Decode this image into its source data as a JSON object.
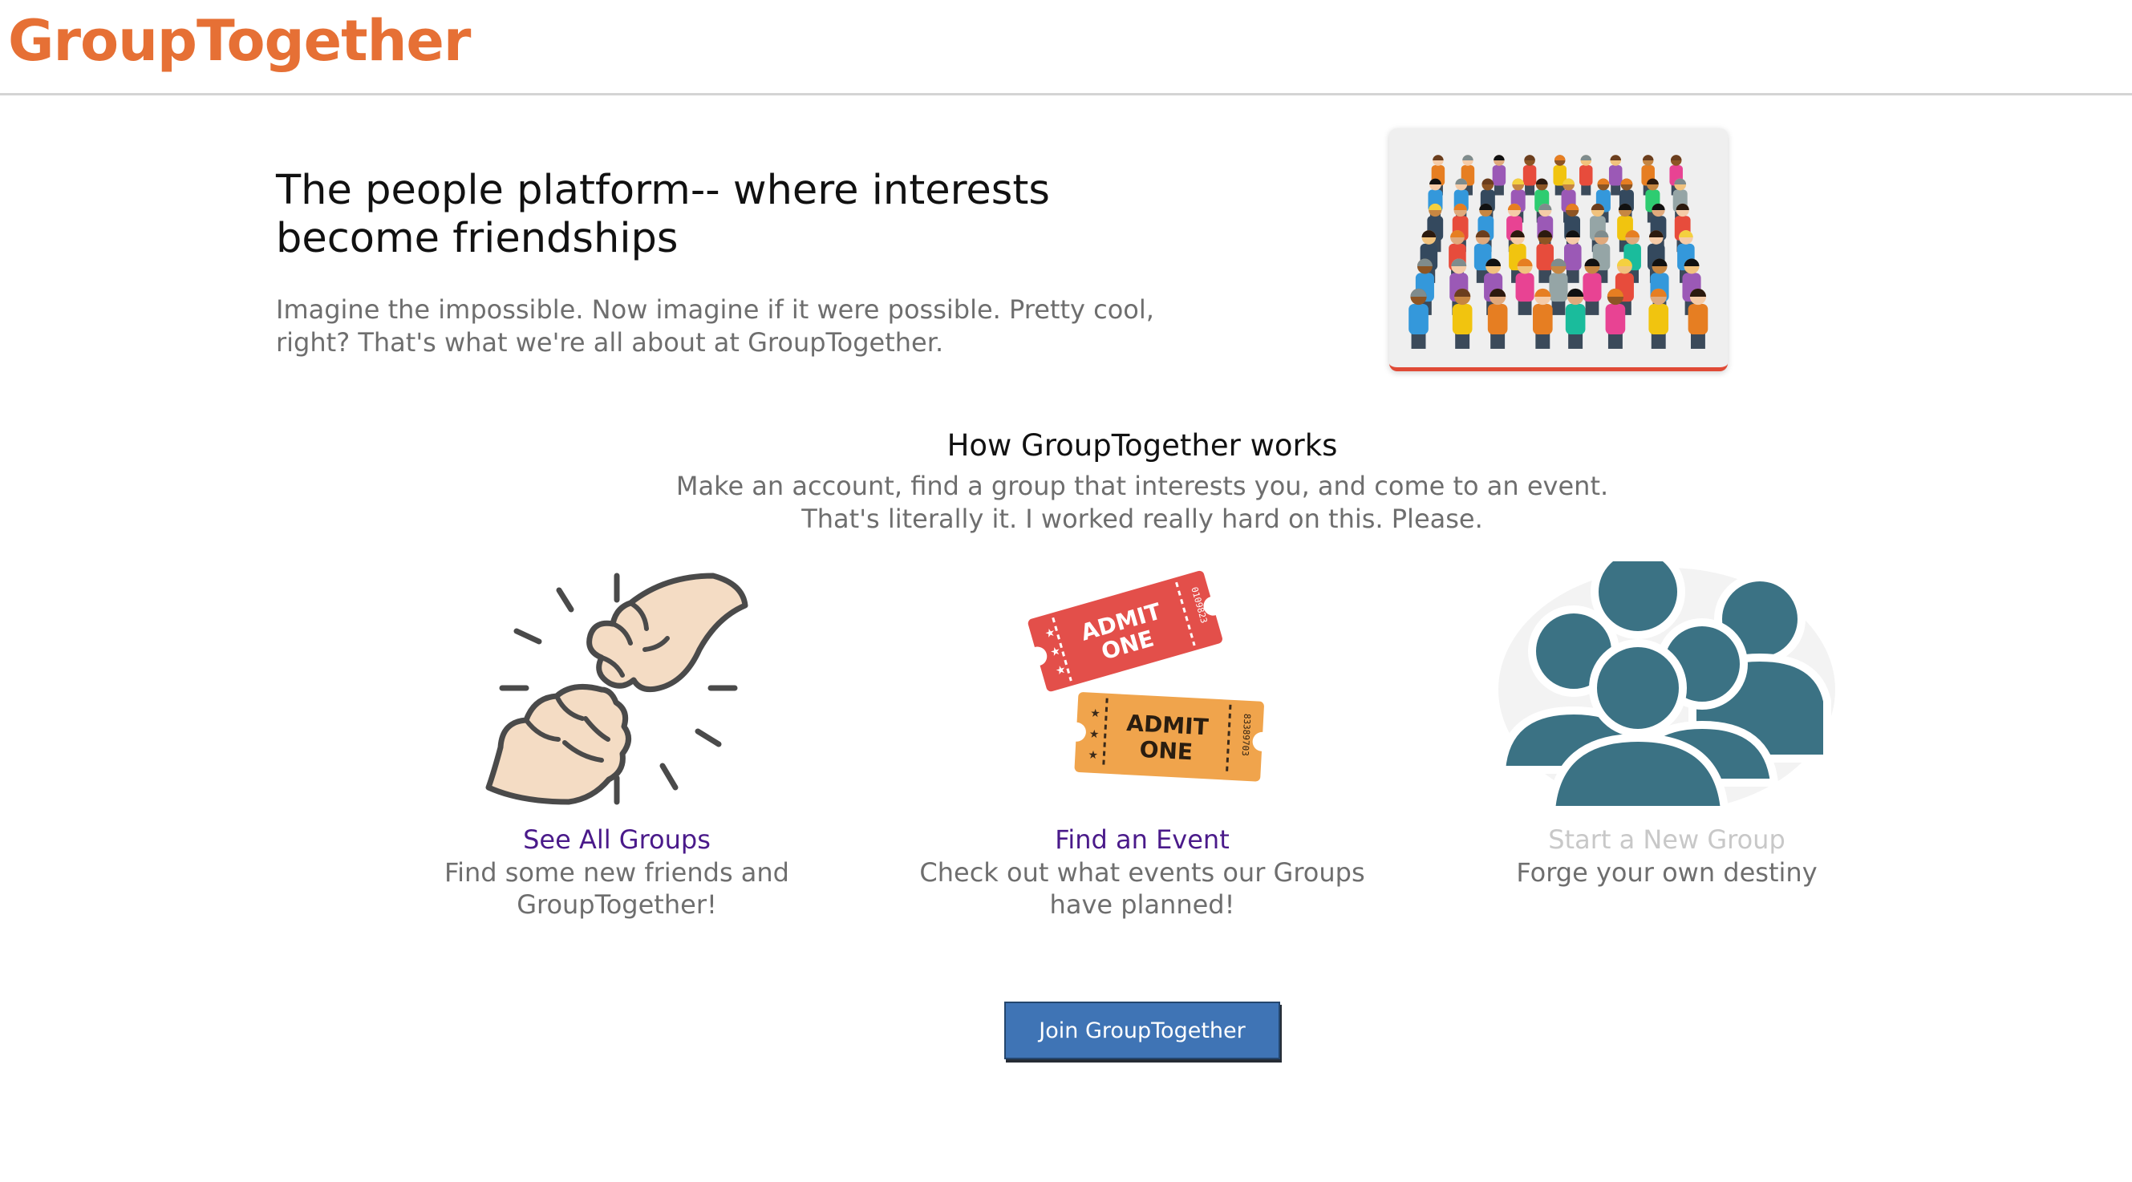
{
  "header": {
    "logo_text": "GroupTogether"
  },
  "hero": {
    "title": "The people platform-- where interests become friendships",
    "description": "Imagine the impossible. Now imagine if it were possible. Pretty cool, right? That's what we're all about at GroupTogether."
  },
  "how_it_works": {
    "title": "How GroupTogether works",
    "line1": "Make an account, find a group that interests you, and come to an event.",
    "line2": "That's literally it. I worked really hard on this. Please."
  },
  "features": [
    {
      "icon": "fist-bump-icon",
      "link_label": "See All Groups",
      "description": "Find some new friends and GroupTogether!"
    },
    {
      "icon": "tickets-icon",
      "link_label": "Find an Event",
      "description": "Check out what events our Groups have planned!",
      "ticket_text": "ADMIT ONE",
      "ticket_serial_1": "0109823",
      "ticket_serial_2": "83389703"
    },
    {
      "icon": "people-group-icon",
      "link_label": "Start a New Group",
      "description": "Forge your own destiny"
    }
  ],
  "cta": {
    "join_label": "Join GroupTogether"
  },
  "colors": {
    "brand": "#e67035",
    "link": "#4a1a8a",
    "muted_link": "#c8c8c8",
    "button": "#3f74b5",
    "people_icon": "#3b7284"
  }
}
